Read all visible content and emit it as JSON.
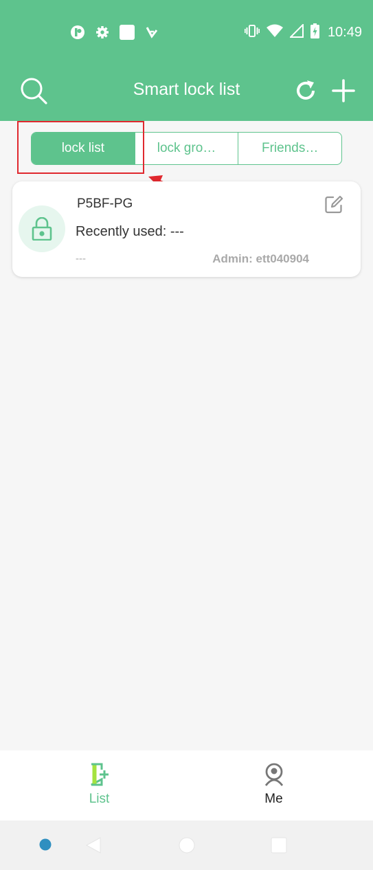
{
  "status_bar": {
    "time": "10:49",
    "left_icons": [
      "app-notification-icon",
      "settings-icon",
      "square-icon",
      "play-store-icon"
    ],
    "right_icons": [
      "vibrate-icon",
      "wifi-icon",
      "signal-icon",
      "battery-charging-icon"
    ]
  },
  "header": {
    "title": "Smart lock list",
    "search_icon": "search-icon",
    "refresh_icon": "refresh-icon",
    "add_icon": "plus-icon"
  },
  "segments": [
    {
      "label": "lock list",
      "active": true
    },
    {
      "label": "lock gro…",
      "active": false
    },
    {
      "label": "Friends…",
      "active": false
    }
  ],
  "locks": [
    {
      "name": "P5BF-PG",
      "recent": "Recently used: ---",
      "sub": "---",
      "admin": "Admin: ett040904"
    }
  ],
  "tabs": [
    {
      "label": "List",
      "icon": "list-door-icon",
      "active": true
    },
    {
      "label": "Me",
      "icon": "person-icon",
      "active": false
    }
  ],
  "colors": {
    "primary": "#5ec38d",
    "annotation": "#e0282e",
    "background": "#f6f6f6"
  }
}
